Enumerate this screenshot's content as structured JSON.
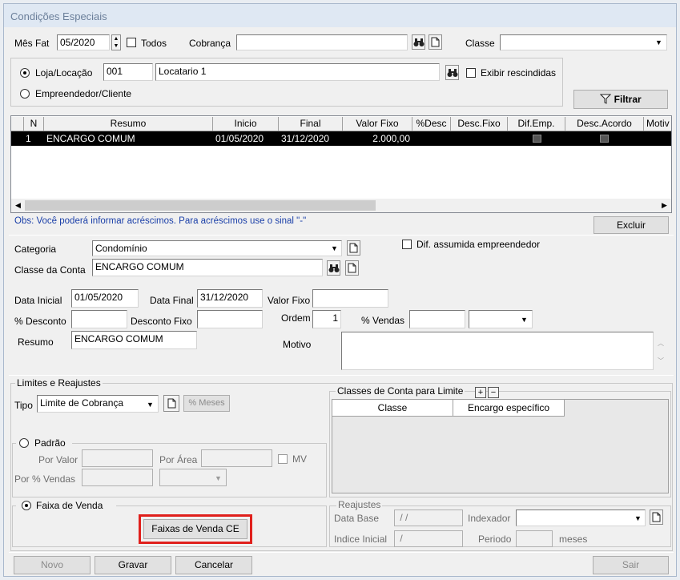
{
  "window": {
    "title": "Condições Especiais"
  },
  "filters": {
    "mes_fat_label": "Mês Fat",
    "mes_fat_value": "05/2020",
    "todos_label": "Todos",
    "cobranca_label": "Cobrança",
    "cobranca_value": "",
    "classe_label": "Classe",
    "classe_value": "",
    "loja_label": "Loja/Locação",
    "loja_code": "001",
    "loja_name": "Locatario 1",
    "exibir_rescindidas_label": "Exibir rescindidas",
    "empreendedor_label": "Empreendedor/Cliente",
    "filtrar_label": "Filtrar"
  },
  "grid": {
    "columns": [
      "N",
      "Resumo",
      "Inicio",
      "Final",
      "Valor Fixo",
      "%Desc",
      "Desc.Fixo",
      "Dif.Emp.",
      "Desc.Acordo",
      "Motiv"
    ],
    "rows": [
      {
        "n": "1",
        "resumo": "ENCARGO COMUM",
        "inicio": "01/05/2020",
        "final": "31/12/2020",
        "valor_fixo": "2.000,00",
        "desc": "",
        "desc_fixo": ""
      }
    ]
  },
  "obs_text": "Obs: Você poderá informar acréscimos. Para acréscimos use o sinal \"-\"",
  "excluir_label": "Excluir",
  "detail": {
    "categoria_label": "Categoria",
    "categoria_value": "Condomínio",
    "dif_assumida_label": "Dif. assumida empreendedor",
    "classe_conta_label": "Classe da Conta",
    "classe_conta_value": "ENCARGO COMUM",
    "data_inicial_label": "Data Inicial",
    "data_inicial_value": "01/05/2020",
    "data_final_label": "Data Final",
    "data_final_value": "31/12/2020",
    "valor_fixo_label": "Valor Fixo",
    "valor_fixo_value": "",
    "desconto_label": "% Desconto",
    "desconto_value": "",
    "desconto_fixo_label": "Desconto Fixo",
    "desconto_fixo_value": "",
    "ordem_label": "Ordem",
    "ordem_value": "1",
    "vendas_label": "% Vendas",
    "vendas_value": "",
    "resumo_label": "Resumo",
    "resumo_value": "ENCARGO COMUM",
    "motivo_label": "Motivo",
    "motivo_value": ""
  },
  "limites": {
    "legend": "Limites e Reajustes",
    "tipo_label": "Tipo",
    "tipo_value": "Limite de Cobrança",
    "meses_label": "% Meses",
    "padrao_label": "Padrão",
    "por_valor_label": "Por Valor",
    "por_area_label": "Por Área",
    "mv_label": "MV",
    "por_vendas_label": "Por % Vendas",
    "faixa_venda_label": "Faixa de Venda",
    "faixas_button_label": "Faixas de Venda CE"
  },
  "classes_limite": {
    "legend": "Classes de Conta para Limite",
    "plus": "+",
    "minus": "−",
    "columns": [
      "Classe",
      "Encargo específico"
    ]
  },
  "reajustes": {
    "legend": "Reajustes",
    "data_base_label": "Data Base",
    "data_base_value": " / /",
    "indexador_label": "Indexador",
    "indexador_value": "",
    "indice_inicial_label": "Indice Inicial",
    "indice_inicial_value": " /",
    "periodo_label": "Periodo",
    "periodo_value": "",
    "meses_label": "meses"
  },
  "footer": {
    "novo": "Novo",
    "gravar": "Gravar",
    "cancelar": "Cancelar",
    "sair": "Sair"
  },
  "highlight_color": "#e0201c",
  "selection_color": "#000000"
}
